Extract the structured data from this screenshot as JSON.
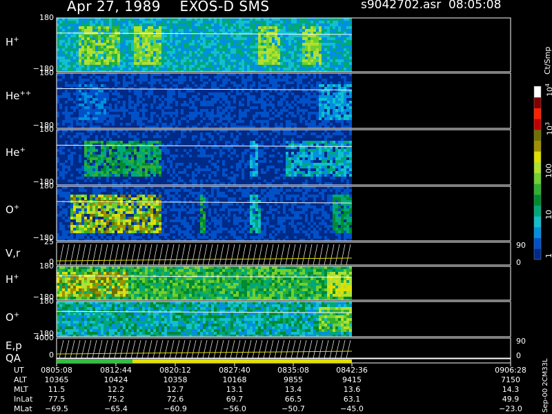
{
  "header": {
    "title": "Apr 27, 1989    EXOS-D SMS",
    "file": "s9042702.asr  08:05:08"
  },
  "side_note": "Sep-00  2CM33L",
  "colorbar": {
    "unit": "Ct/Smp",
    "ticks": [
      "1",
      "10",
      "100",
      "10",
      "10"
    ],
    "exponents": [
      "",
      "",
      "",
      "3",
      "4"
    ],
    "colors": [
      "#002a88",
      "#0050c8",
      "#0090e0",
      "#10c0d0",
      "#00a878",
      "#008a30",
      "#30b030",
      "#70d030",
      "#b0e030",
      "#e0e000",
      "#a09000",
      "#707000",
      "#c00000",
      "#ff2000",
      "#800000",
      "#ffffff"
    ]
  },
  "panels": [
    {
      "id": "h-plus",
      "label": "H",
      "sup": "+",
      "top": "180",
      "bottom": "−180"
    },
    {
      "id": "he-plusplus",
      "label": "He",
      "sup": "++",
      "top": "180",
      "bottom": "−180"
    },
    {
      "id": "he-plus",
      "label": "He",
      "sup": "+",
      "top": "180",
      "bottom": "−180"
    },
    {
      "id": "o-plus",
      "label": "O",
      "sup": "+",
      "top": "180",
      "bottom": "−180"
    },
    {
      "id": "vr",
      "label": "V,r",
      "sup": "",
      "top": "25",
      "bottom": "0",
      "right_top": "90",
      "right_bottom": "0"
    },
    {
      "id": "h-plus-2",
      "label": "H",
      "sup": "+",
      "top": "180",
      "bottom": "−180"
    },
    {
      "id": "o-plus-2",
      "label": "O",
      "sup": "+",
      "top": "180",
      "bottom": "−180"
    },
    {
      "id": "ep",
      "label": "E,p",
      "sup": "",
      "top": "4000",
      "bottom": "0",
      "right_top": "90",
      "right_bottom": "0"
    },
    {
      "id": "qa",
      "label": "QA",
      "sup": ""
    }
  ],
  "footer": {
    "labels": [
      "UT",
      "ALT",
      "MLT",
      "InLat",
      "MLat"
    ],
    "columns": [
      [
        "0805:08",
        "10365",
        "11.5",
        "77.5",
        "−69.5"
      ],
      [
        "0812:44",
        "10424",
        "12.2",
        "75.2",
        "−65.4"
      ],
      [
        "0820:12",
        "10358",
        "12.7",
        "72.6",
        "−60.9"
      ],
      [
        "0827:40",
        "10168",
        "13.1",
        "69.7",
        "−56.0"
      ],
      [
        "0835:08",
        "9855",
        "13.4",
        "66.5",
        "−50.7"
      ],
      [
        "0842:36",
        "9415",
        "13.6",
        "63.1",
        "−45.0"
      ],
      [
        "0906:28",
        "7150",
        "14.3",
        "49.9",
        "−23.0"
      ]
    ]
  },
  "chart_data": {
    "type": "heatmap",
    "title": "Apr 27, 1989    EXOS-D SMS",
    "x_ticks": [
      "0805:08",
      "0812:44",
      "0820:12",
      "0827:40",
      "0835:08",
      "0842:36",
      "0906:28"
    ],
    "colorbar_label": "Ct/Smp",
    "colorbar_scale": "log",
    "colorbar_range": [
      1,
      10000
    ],
    "panels": [
      "H+",
      "He++",
      "He+",
      "O+",
      "V,r",
      "H+",
      "O+",
      "E,p",
      "QA"
    ]
  }
}
